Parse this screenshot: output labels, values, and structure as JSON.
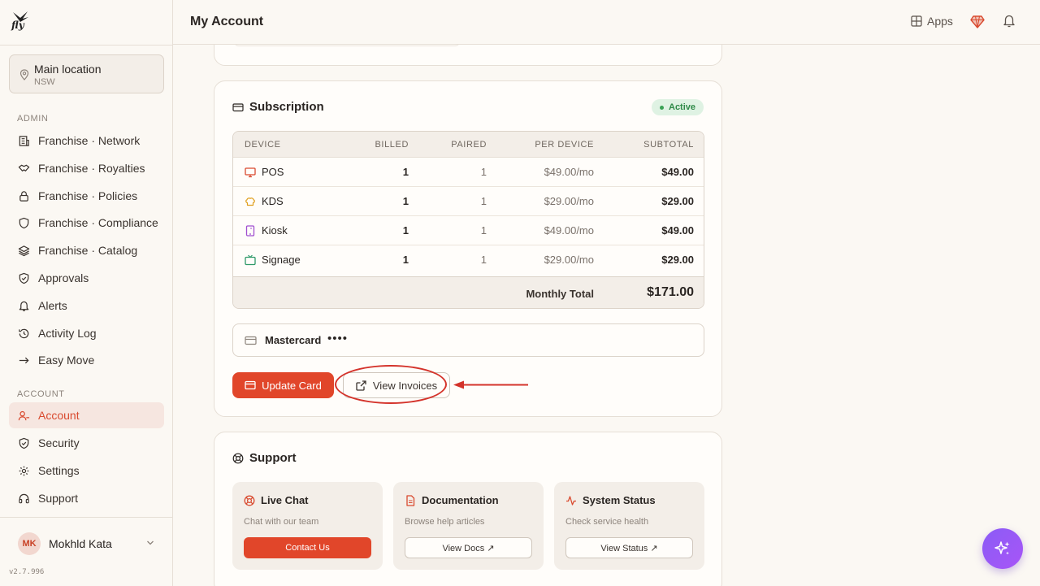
{
  "brand": {
    "logo_text": "fly"
  },
  "location": {
    "name": "Main location",
    "region": "NSW"
  },
  "sidebar": {
    "admin_label": "ADMIN",
    "admin_items": [
      {
        "label": "Franchise · Network",
        "icon": "building-icon"
      },
      {
        "label": "Franchise · Royalties",
        "icon": "handshake-icon"
      },
      {
        "label": "Franchise · Policies",
        "icon": "lock-icon"
      },
      {
        "label": "Franchise · Compliance",
        "icon": "shield-icon"
      },
      {
        "label": "Franchise · Catalog",
        "icon": "layers-icon"
      },
      {
        "label": "Approvals",
        "icon": "shield-check-icon"
      },
      {
        "label": "Alerts",
        "icon": "bell-icon"
      },
      {
        "label": "Activity Log",
        "icon": "history-icon"
      },
      {
        "label": "Easy Move",
        "icon": "arrow-right-icon"
      }
    ],
    "account_label": "ACCOUNT",
    "account_items": [
      {
        "label": "Account",
        "icon": "user-icon",
        "active": true
      },
      {
        "label": "Security",
        "icon": "shield-icon"
      },
      {
        "label": "Settings",
        "icon": "gear-icon"
      },
      {
        "label": "Support",
        "icon": "headset-icon"
      }
    ]
  },
  "user": {
    "initials": "MK",
    "name": "Mokhld Kata"
  },
  "version": "v2.7.996",
  "header": {
    "title": "My Account",
    "apps_label": "Apps"
  },
  "subscription": {
    "title": "Subscription",
    "status": "Active",
    "columns": [
      "DEVICE",
      "BILLED",
      "PAIRED",
      "PER DEVICE",
      "SUBTOTAL"
    ],
    "rows": [
      {
        "device": "POS",
        "billed": "1",
        "paired": "1",
        "per_device": "$49.00/mo",
        "subtotal": "$49.00",
        "icon": "monitor-icon",
        "color": "#d94a2f"
      },
      {
        "device": "KDS",
        "billed": "1",
        "paired": "1",
        "per_device": "$29.00/mo",
        "subtotal": "$29.00",
        "icon": "chef-hat-icon",
        "color": "#e0a020"
      },
      {
        "device": "Kiosk",
        "billed": "1",
        "paired": "1",
        "per_device": "$49.00/mo",
        "subtotal": "$49.00",
        "icon": "tablet-icon",
        "color": "#a04fd0"
      },
      {
        "device": "Signage",
        "billed": "1",
        "paired": "1",
        "per_device": "$29.00/mo",
        "subtotal": "$29.00",
        "icon": "tv-icon",
        "color": "#2f9a6a"
      }
    ],
    "total_label": "Monthly Total",
    "total_value": "$171.00",
    "payment": {
      "card_name": "Mastercard",
      "masked": "••••"
    },
    "update_card_label": "Update Card",
    "view_invoices_label": "View Invoices"
  },
  "support": {
    "title": "Support",
    "tiles": [
      {
        "title": "Live Chat",
        "desc": "Chat with our team",
        "button": "Contact Us",
        "icon": "lifebuoy-icon"
      },
      {
        "title": "Documentation",
        "desc": "Browse help articles",
        "button": "View Docs ↗",
        "icon": "document-icon"
      },
      {
        "title": "System Status",
        "desc": "Check service health",
        "button": "View Status ↗",
        "icon": "activity-icon"
      }
    ]
  },
  "colors": {
    "accent": "#e1462a",
    "active_bg": "#f6e6e0",
    "status_green": "#2f8a48"
  }
}
